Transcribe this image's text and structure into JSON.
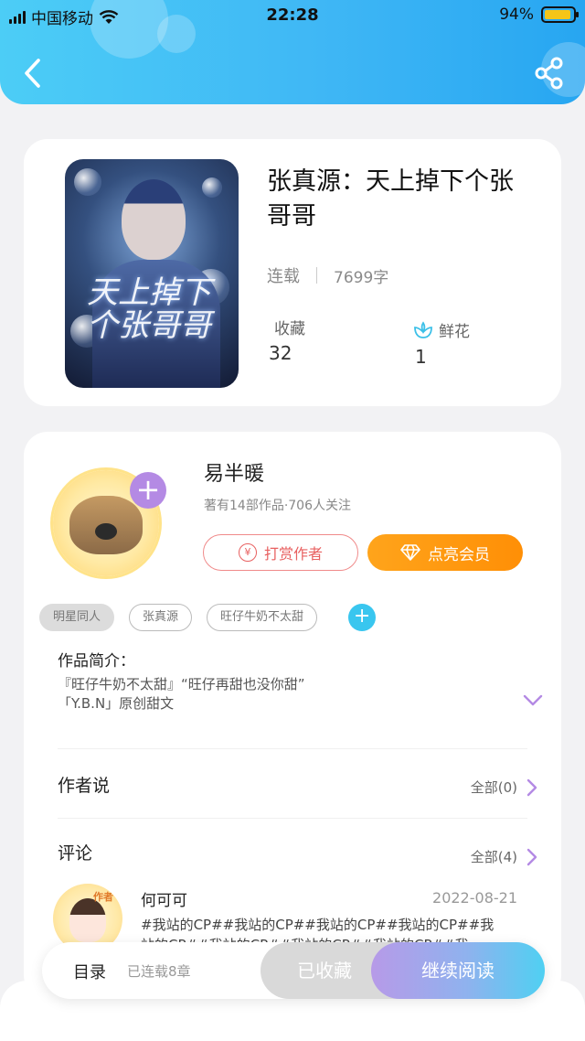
{
  "status_bar": {
    "carrier": "中国移动",
    "time": "22:28",
    "battery_percent": "94%",
    "battery_level": 0.94
  },
  "header": {
    "back_icon": "chevron-left-icon",
    "share_icon": "share-icon",
    "gradient_colors": [
      "#4ccdf6",
      "#27a6f1"
    ]
  },
  "book": {
    "title": "张真源：天上掉下个张哥哥",
    "cover_text": "天上掉下个张哥哥",
    "status": "连载",
    "word_count": "7699字",
    "favorites_label": "收藏",
    "favorites_value": "32",
    "flowers_label": "鲜花",
    "flowers_value": "1"
  },
  "author": {
    "name": "易半暖",
    "summary": "著有14部作品·706人关注",
    "follow_symbol": "+",
    "reward_label": "打赏作者",
    "reward_symbol": "¥",
    "vip_label": "点亮会员"
  },
  "tags": {
    "items": [
      "明星同人",
      "张真源",
      "旺仔牛奶不太甜"
    ],
    "add_symbol": "+"
  },
  "intro": {
    "label": "作品简介：",
    "line1": "『旺仔牛奶不太甜』“旺仔再甜也没你甜”",
    "line2": "「Y.B.N」原创甜文"
  },
  "author_says": {
    "label": "作者说",
    "more": "全部(0)"
  },
  "comments": {
    "label": "评论",
    "more": "全部(4)",
    "first": {
      "name": "何可可",
      "date": "2022-08-21",
      "badge": "作者",
      "text": "#我站的CP##我站的CP##我站的CP##我站的CP##我站的CP##我站的CP##我站的CP##我站的CP##我"
    }
  },
  "bottom_bar": {
    "toc_label": "目录",
    "toc_status": "已连载8章",
    "saved_label": "已收藏",
    "read_label": "继续阅读"
  },
  "colors": {
    "accent_purple": "#b48ae4",
    "vip_orange": "#ff9a10",
    "reward_red": "#e86060",
    "tag_add_blue": "#39c6ef"
  }
}
